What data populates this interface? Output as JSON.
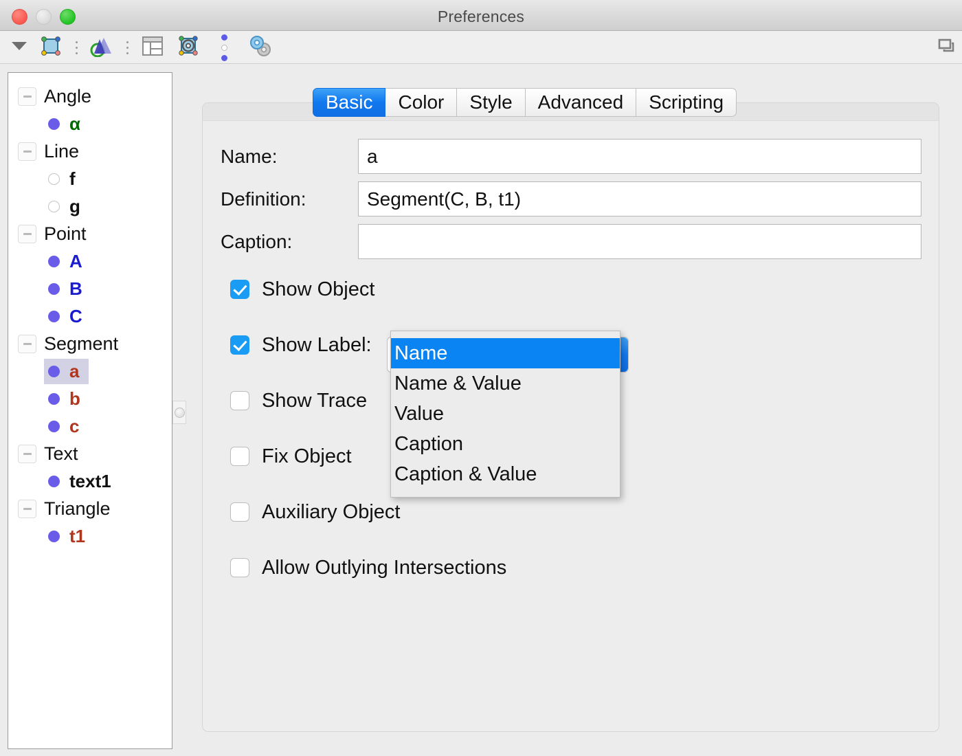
{
  "window": {
    "title": "Preferences",
    "traffic": [
      "close-button",
      "minimize-button",
      "zoom-button"
    ]
  },
  "toolbar": {
    "items": [
      {
        "name": "toolbar-dropdown-arrow",
        "icon": "chevron-down-icon"
      },
      {
        "name": "toolbar-algebra-view",
        "icon": "algebra-view-icon"
      },
      {
        "name": "toolbar-separator-dots-1",
        "icon": "vertical-dots-icon"
      },
      {
        "name": "toolbar-3d-view",
        "icon": "triangle-3d-icon"
      },
      {
        "name": "toolbar-separator-dots-2",
        "icon": "vertical-dots-icon"
      },
      {
        "name": "toolbar-layout",
        "icon": "layout-panels-icon"
      },
      {
        "name": "toolbar-object-properties",
        "icon": "object-gear-icon"
      },
      {
        "name": "toolbar-defaults",
        "icon": "blue-dots-icon"
      },
      {
        "name": "toolbar-global-settings",
        "icon": "gears-icon"
      }
    ],
    "right_icon": "window-restore-icon"
  },
  "sidebar": {
    "groups": [
      {
        "label": "Angle",
        "expanded": true,
        "items": [
          {
            "label": "α",
            "color": "#006a00",
            "bullet": "filled",
            "selected": false
          }
        ]
      },
      {
        "label": "Line",
        "expanded": true,
        "items": [
          {
            "label": "f",
            "color": "#111111",
            "bullet": "hollow",
            "selected": false
          },
          {
            "label": "g",
            "color": "#111111",
            "bullet": "hollow",
            "selected": false
          }
        ]
      },
      {
        "label": "Point",
        "expanded": true,
        "items": [
          {
            "label": "A",
            "color": "#1a1ad0",
            "bullet": "filled",
            "selected": false
          },
          {
            "label": "B",
            "color": "#1a1ad0",
            "bullet": "filled",
            "selected": false
          },
          {
            "label": "C",
            "color": "#1a1ad0",
            "bullet": "filled",
            "selected": false
          }
        ]
      },
      {
        "label": "Segment",
        "expanded": true,
        "items": [
          {
            "label": "a",
            "color": "#b0361e",
            "bullet": "filled",
            "selected": true
          },
          {
            "label": "b",
            "color": "#b0361e",
            "bullet": "filled",
            "selected": false
          },
          {
            "label": "c",
            "color": "#b0361e",
            "bullet": "filled",
            "selected": false
          }
        ]
      },
      {
        "label": "Text",
        "expanded": true,
        "items": [
          {
            "label": "text1",
            "color": "#111111",
            "bullet": "filled",
            "selected": false
          }
        ]
      },
      {
        "label": "Triangle",
        "expanded": true,
        "items": [
          {
            "label": "t1",
            "color": "#b0361e",
            "bullet": "filled",
            "selected": false
          }
        ]
      }
    ]
  },
  "tabs": [
    {
      "label": "Basic",
      "active": true
    },
    {
      "label": "Color",
      "active": false
    },
    {
      "label": "Style",
      "active": false
    },
    {
      "label": "Advanced",
      "active": false
    },
    {
      "label": "Scripting",
      "active": false
    }
  ],
  "form": {
    "name_label": "Name:",
    "name_value": "a",
    "definition_label": "Definition:",
    "definition_value": "Segment(C, B, t1)",
    "caption_label": "Caption:",
    "caption_value": ""
  },
  "checkboxes": [
    {
      "label": "Show Object",
      "checked": true
    },
    {
      "label": "Show Label:",
      "checked": true
    },
    {
      "label": "Show Trace",
      "checked": false
    },
    {
      "label": "Fix Object",
      "checked": false
    },
    {
      "label": "Auxiliary Object",
      "checked": false
    },
    {
      "label": "Allow Outlying Intersections",
      "checked": false
    }
  ],
  "label_combo": {
    "value": "Name",
    "options": [
      {
        "label": "Name",
        "selected": true
      },
      {
        "label": "Name & Value",
        "selected": false
      },
      {
        "label": "Value",
        "selected": false
      },
      {
        "label": "Caption",
        "selected": false
      },
      {
        "label": "Caption & Value",
        "selected": false
      }
    ]
  },
  "colors": {
    "accent_blue": "#0b84f3",
    "checkbox_blue": "#1a9cf5",
    "selection_lavender": "#d2d2e4",
    "bullet_purple": "#6a5ce8",
    "segment_red": "#b0361e",
    "point_blue": "#1a1ad0",
    "angle_green": "#006a00"
  }
}
